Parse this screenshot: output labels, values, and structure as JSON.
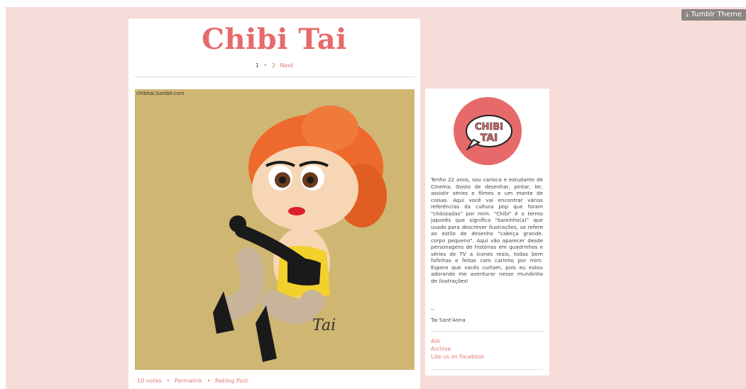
{
  "dashboard": {
    "theme_button": "⤓ Tumblr Theme"
  },
  "blog": {
    "title": "Chibi Tai"
  },
  "pagination": {
    "page1": "1",
    "sep": "•",
    "page2": "2",
    "next": "Next"
  },
  "post": {
    "watermark": "chibitai.tumblr.com",
    "signature_art": "Tai",
    "notes": "10 notes",
    "permalink": "Permalink",
    "reblog": "Reblog Post",
    "sep": "•"
  },
  "sidebar": {
    "avatar_text_top": "CHIBI",
    "avatar_text_bottom": "TAI",
    "bio": "Tenho 22 anos, sou carioca e estudante de Cinema. Gosto de desenhar, pintar, ler, assistir séries e filmes e um monte de coisas. Aqui você vai encontrar várias referências da cultura pop que foram \"chibizadas\" por mim. \"Chibi\" é o termo japonês que significa \"baixinho(a)\" que usado para descrever ilustrações, se refere ao estilo de desenho \"cabeça grande, corpo pequeno\". Aqui vão aparecer desde personagens de histórias em quadrinhos e séries de TV a ícones reais, todas bem fofinhas e feitas com carinho por mim. Espero que vocês curtam, pois eu estou adorando me aventurar nesse mundinho de ilustrações!",
    "dash": "--",
    "signature": "Tai Sant'Anna",
    "links": [
      "Ask",
      "Archive",
      "Like us on Facebook"
    ]
  },
  "colors": {
    "background": "#f6dcd8",
    "accent": "#e66a6a",
    "link": "#e07b74",
    "image_bg": "#cfb672"
  }
}
